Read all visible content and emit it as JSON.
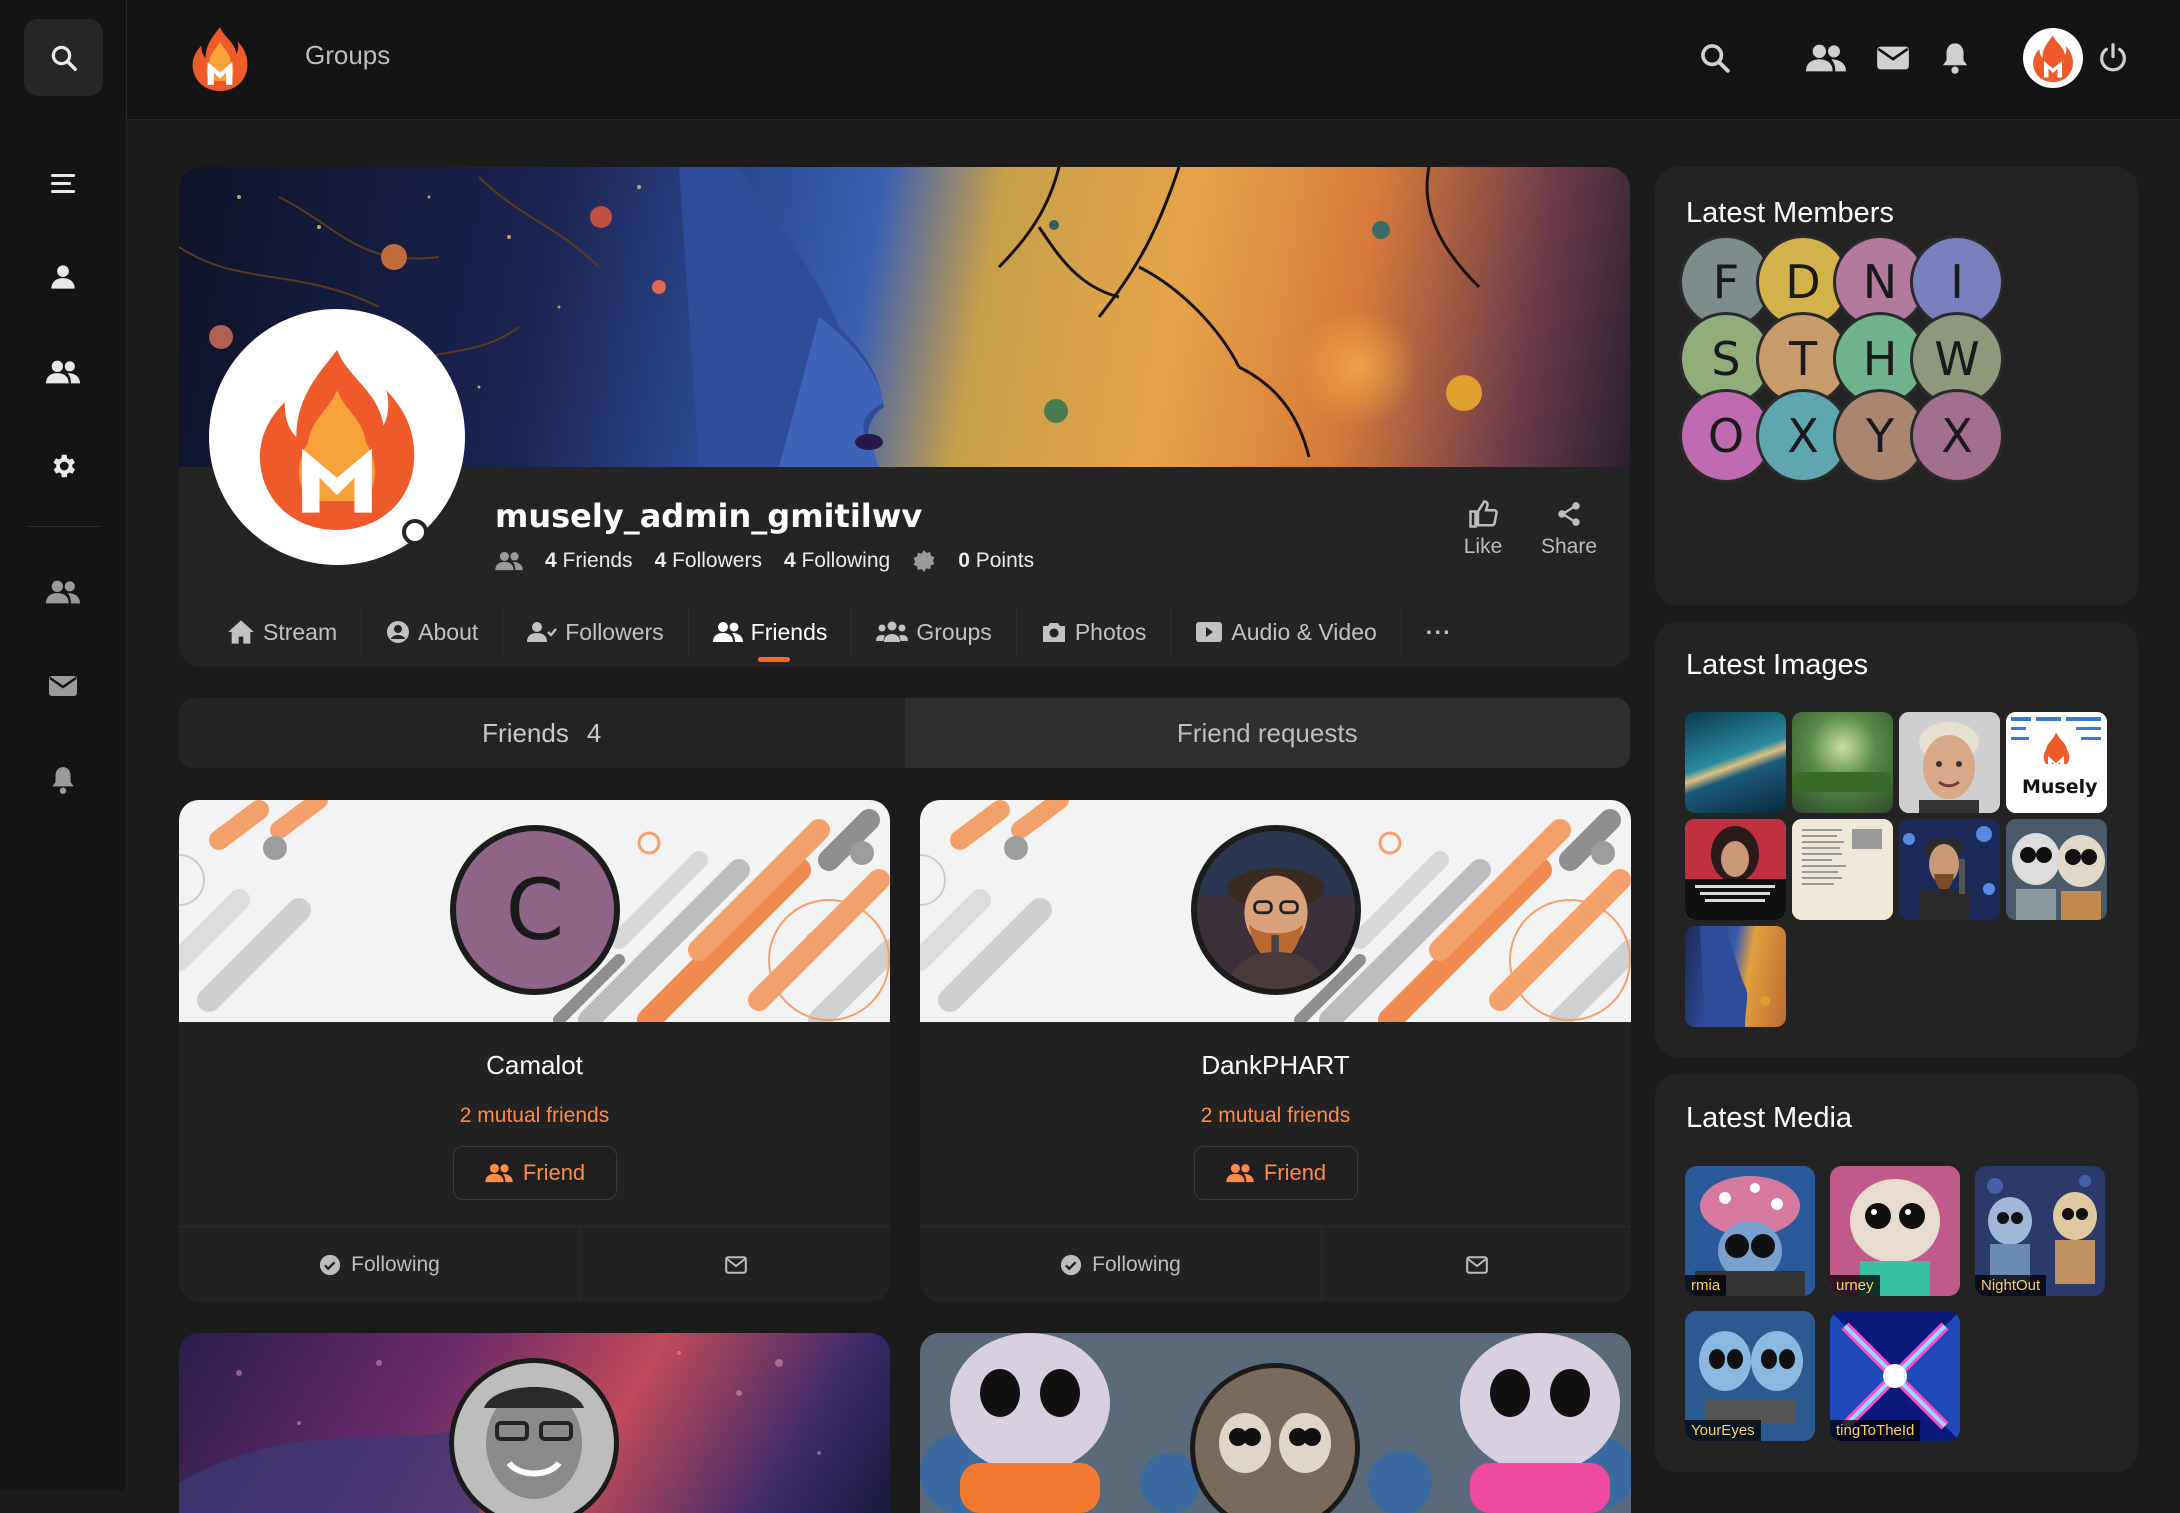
{
  "header": {
    "breadcrumb": "Groups"
  },
  "profile": {
    "username": "musely_admin_gmitilwv",
    "friends_count": "4",
    "friends_label": "Friends",
    "followers_count": "4",
    "followers_label": "Followers",
    "following_count": "4",
    "following_label": "Following",
    "points_count": "0",
    "points_label": "Points",
    "like_label": "Like",
    "share_label": "Share"
  },
  "tabs": [
    {
      "label": "Stream",
      "icon": "home-icon"
    },
    {
      "label": "About",
      "icon": "user-circle-icon"
    },
    {
      "label": "Followers",
      "icon": "user-check-icon"
    },
    {
      "label": "Friends",
      "icon": "users-icon"
    },
    {
      "label": "Groups",
      "icon": "users-group-icon"
    },
    {
      "label": "Photos",
      "icon": "camera-icon"
    },
    {
      "label": "Audio & Video",
      "icon": "video-icon"
    },
    {
      "label": "···",
      "icon": "more-icon"
    }
  ],
  "subtabs": {
    "friends_label": "Friends",
    "friends_count": "4",
    "requests_label": "Friend requests"
  },
  "friends": [
    {
      "name": "Camalot",
      "initial": "C",
      "mutual": "2 mutual friends",
      "button": "Friend",
      "following": "Following"
    },
    {
      "name": "DankPHART",
      "initial": "",
      "mutual": "2 mutual friends",
      "button": "Friend",
      "following": "Following"
    }
  ],
  "widgets": {
    "latest_members_title": "Latest Members",
    "latest_images_title": "Latest Images",
    "latest_media_title": "Latest Media",
    "members": [
      {
        "letter": "F",
        "color": "#7e8c8c"
      },
      {
        "letter": "D",
        "color": "#d4b24a"
      },
      {
        "letter": "N",
        "color": "#b47a9e"
      },
      {
        "letter": "I",
        "color": "#7a7fbd"
      },
      {
        "letter": "S",
        "color": "#8fae7c"
      },
      {
        "letter": "T",
        "color": "#c89c6a"
      },
      {
        "letter": "H",
        "color": "#6fb48f"
      },
      {
        "letter": "W",
        "color": "#8e987a"
      },
      {
        "letter": "O",
        "color": "#bf6bb0"
      },
      {
        "letter": "X",
        "color": "#5fa6ae"
      },
      {
        "letter": "Y",
        "color": "#a88670"
      },
      {
        "letter": "X",
        "color": "#a0708e"
      }
    ],
    "image_thumb_text": "Musely",
    "media_labels": [
      "rmia",
      "urney",
      "NightOut",
      "YourEyes",
      "tingToTheId"
    ]
  },
  "colors": {
    "accent": "#ff6a2a",
    "mutual": "#ff8a4a"
  }
}
